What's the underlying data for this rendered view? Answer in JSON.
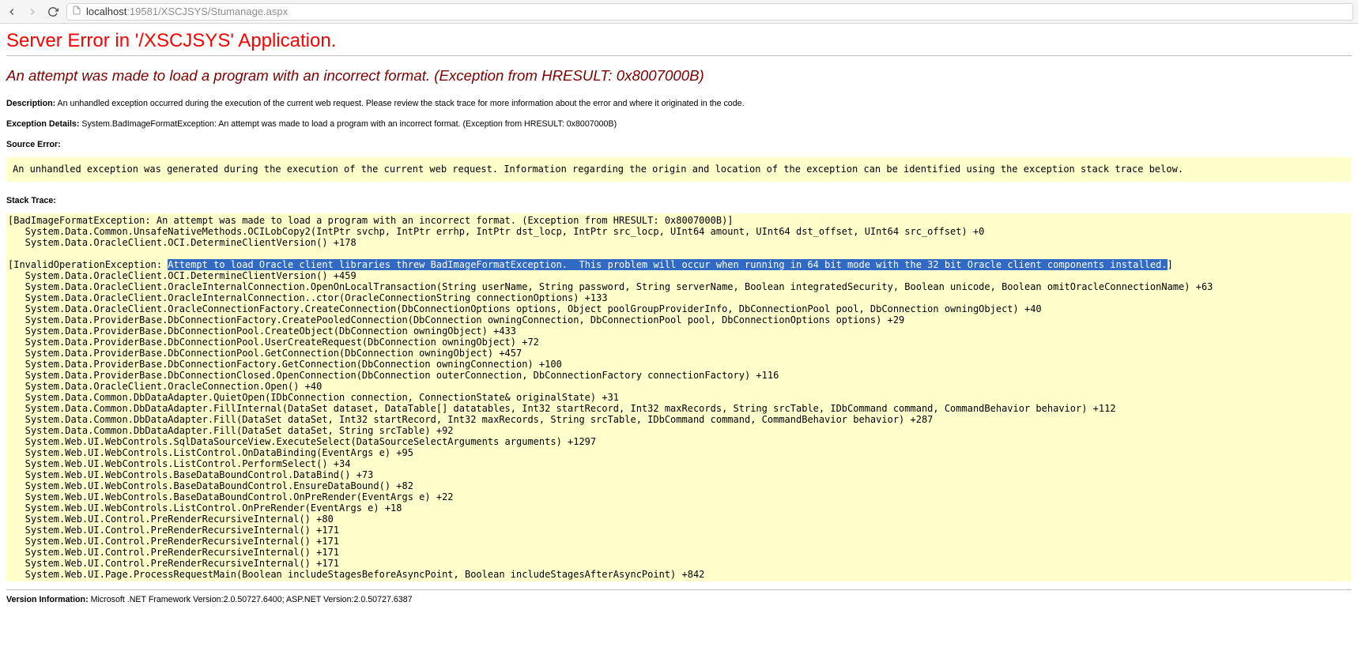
{
  "browser": {
    "url_host": "localhost",
    "url_port_path": ":19581/XSCJSYS/Stumanage.aspx"
  },
  "error": {
    "title": "Server Error in '/XSCJSYS' Application.",
    "subtitle": "An attempt was made to load a program with an incorrect format. (Exception from HRESULT: 0x8007000B)",
    "description_label": "Description:",
    "description_text": "An unhandled exception occurred during the execution of the current web request. Please review the stack trace for more information about the error and where it originated in the code.",
    "exception_details_label": "Exception Details:",
    "exception_details_text": "System.BadImageFormatException: An attempt was made to load a program with an incorrect format. (Exception from HRESULT: 0x8007000B)",
    "source_error_label": "Source Error:",
    "source_error_text": "An unhandled exception was generated during the execution of the current web request. Information regarding the origin and location of the exception can be identified using the exception stack trace below.",
    "stack_trace_label": "Stack Trace:",
    "stack_block1_line1": "[BadImageFormatException: An attempt was made to load a program with an incorrect format. (Exception from HRESULT: 0x8007000B)]",
    "stack_block1_line2": "   System.Data.Common.UnsafeNativeMethods.OCILobCopy2(IntPtr svchp, IntPtr errhp, IntPtr dst_locp, IntPtr src_locp, UInt64 amount, UInt64 dst_offset, UInt64 src_offset) +0",
    "stack_block1_line3": "   System.Data.OracleClient.OCI.DetermineClientVersion() +178",
    "stack_block2_prefix": "[InvalidOperationException: ",
    "stack_block2_highlight": "Attempt to load Oracle client libraries threw BadImageFormatException.  This problem will occur when running in 64 bit mode with the 32 bit Oracle client components installed.",
    "stack_block2_suffix": "]",
    "stack_rest": "   System.Data.OracleClient.OCI.DetermineClientVersion() +459\n   System.Data.OracleClient.OracleInternalConnection.OpenOnLocalTransaction(String userName, String password, String serverName, Boolean integratedSecurity, Boolean unicode, Boolean omitOracleConnectionName) +63\n   System.Data.OracleClient.OracleInternalConnection..ctor(OracleConnectionString connectionOptions) +133\n   System.Data.OracleClient.OracleConnectionFactory.CreateConnection(DbConnectionOptions options, Object poolGroupProviderInfo, DbConnectionPool pool, DbConnection owningObject) +40\n   System.Data.ProviderBase.DbConnectionFactory.CreatePooledConnection(DbConnection owningConnection, DbConnectionPool pool, DbConnectionOptions options) +29\n   System.Data.ProviderBase.DbConnectionPool.CreateObject(DbConnection owningObject) +433\n   System.Data.ProviderBase.DbConnectionPool.UserCreateRequest(DbConnection owningObject) +72\n   System.Data.ProviderBase.DbConnectionPool.GetConnection(DbConnection owningObject) +457\n   System.Data.ProviderBase.DbConnectionFactory.GetConnection(DbConnection owningConnection) +100\n   System.Data.ProviderBase.DbConnectionClosed.OpenConnection(DbConnection outerConnection, DbConnectionFactory connectionFactory) +116\n   System.Data.OracleClient.OracleConnection.Open() +40\n   System.Data.Common.DbDataAdapter.QuietOpen(IDbConnection connection, ConnectionState& originalState) +31\n   System.Data.Common.DbDataAdapter.FillInternal(DataSet dataset, DataTable[] datatables, Int32 startRecord, Int32 maxRecords, String srcTable, IDbCommand command, CommandBehavior behavior) +112\n   System.Data.Common.DbDataAdapter.Fill(DataSet dataSet, Int32 startRecord, Int32 maxRecords, String srcTable, IDbCommand command, CommandBehavior behavior) +287\n   System.Data.Common.DbDataAdapter.Fill(DataSet dataSet, String srcTable) +92\n   System.Web.UI.WebControls.SqlDataSourceView.ExecuteSelect(DataSourceSelectArguments arguments) +1297\n   System.Web.UI.WebControls.ListControl.OnDataBinding(EventArgs e) +95\n   System.Web.UI.WebControls.ListControl.PerformSelect() +34\n   System.Web.UI.WebControls.BaseDataBoundControl.DataBind() +73\n   System.Web.UI.WebControls.BaseDataBoundControl.EnsureDataBound() +82\n   System.Web.UI.WebControls.BaseDataBoundControl.OnPreRender(EventArgs e) +22\n   System.Web.UI.WebControls.ListControl.OnPreRender(EventArgs e) +18\n   System.Web.UI.Control.PreRenderRecursiveInternal() +80\n   System.Web.UI.Control.PreRenderRecursiveInternal() +171\n   System.Web.UI.Control.PreRenderRecursiveInternal() +171\n   System.Web.UI.Control.PreRenderRecursiveInternal() +171\n   System.Web.UI.Control.PreRenderRecursiveInternal() +171\n   System.Web.UI.Page.ProcessRequestMain(Boolean includeStagesBeforeAsyncPoint, Boolean includeStagesAfterAsyncPoint) +842",
    "version_label": "Version Information:",
    "version_text": "Microsoft .NET Framework Version:2.0.50727.6400; ASP.NET Version:2.0.50727.6387"
  }
}
